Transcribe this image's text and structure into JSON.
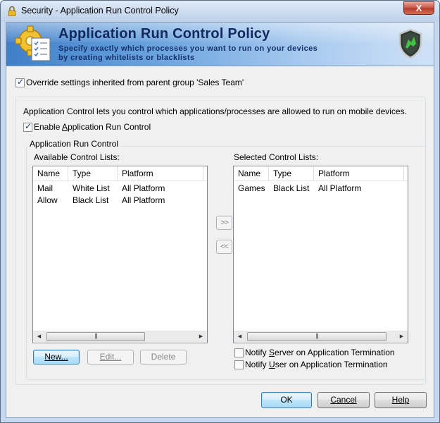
{
  "window": {
    "title": "Security - Application Run Control Policy",
    "close_label": "X"
  },
  "banner": {
    "title": "Application Run Control Policy",
    "subtitle_line1": "Specify exactly which processes you want to run on your devices",
    "subtitle_line2": "by creating whitelists or blacklists"
  },
  "override": {
    "checked": true,
    "label": "Override settings inherited from parent group 'Sales Team'"
  },
  "panel": {
    "description": "Application Control lets you control which applications/processes are allowed to run on mobile devices.",
    "enable": {
      "checked": true,
      "label_pre": "Enable ",
      "label_access": "A",
      "label_post": "pplication Run Control"
    },
    "group_label": "Application Run Control"
  },
  "available": {
    "label": "Available Control Lists:",
    "columns": [
      "Name",
      "Type",
      "Platform"
    ],
    "rows": [
      {
        "name": "Mail",
        "type": "White List",
        "platform": "All Platform"
      },
      {
        "name": "Allow",
        "type": "Black List",
        "platform": "All Platform"
      }
    ]
  },
  "selected": {
    "label": "Selected Control Lists:",
    "columns": [
      "Name",
      "Type",
      "Platform"
    ],
    "rows": [
      {
        "name": "Games",
        "type": "Black List",
        "platform": "All Platform"
      }
    ]
  },
  "transfer": {
    "add_label": ">>",
    "remove_label": "<<"
  },
  "list_buttons": {
    "new_label": "New...",
    "edit_label": "Edit...",
    "delete_label": "Delete"
  },
  "notify": {
    "server": {
      "checked": false,
      "label_pre": "Notify ",
      "label_access": "S",
      "label_post": "erver on Application Termination"
    },
    "user": {
      "checked": false,
      "label_pre": "Notify ",
      "label_access": "U",
      "label_post": "ser on Application Termination"
    }
  },
  "footer": {
    "ok_label": "OK",
    "cancel_label": "Cancel",
    "help_label": "Help"
  },
  "colors": {
    "banner_title": "#12295e",
    "default_button_border": "#3c7fb1",
    "close_button": "#c75142"
  }
}
